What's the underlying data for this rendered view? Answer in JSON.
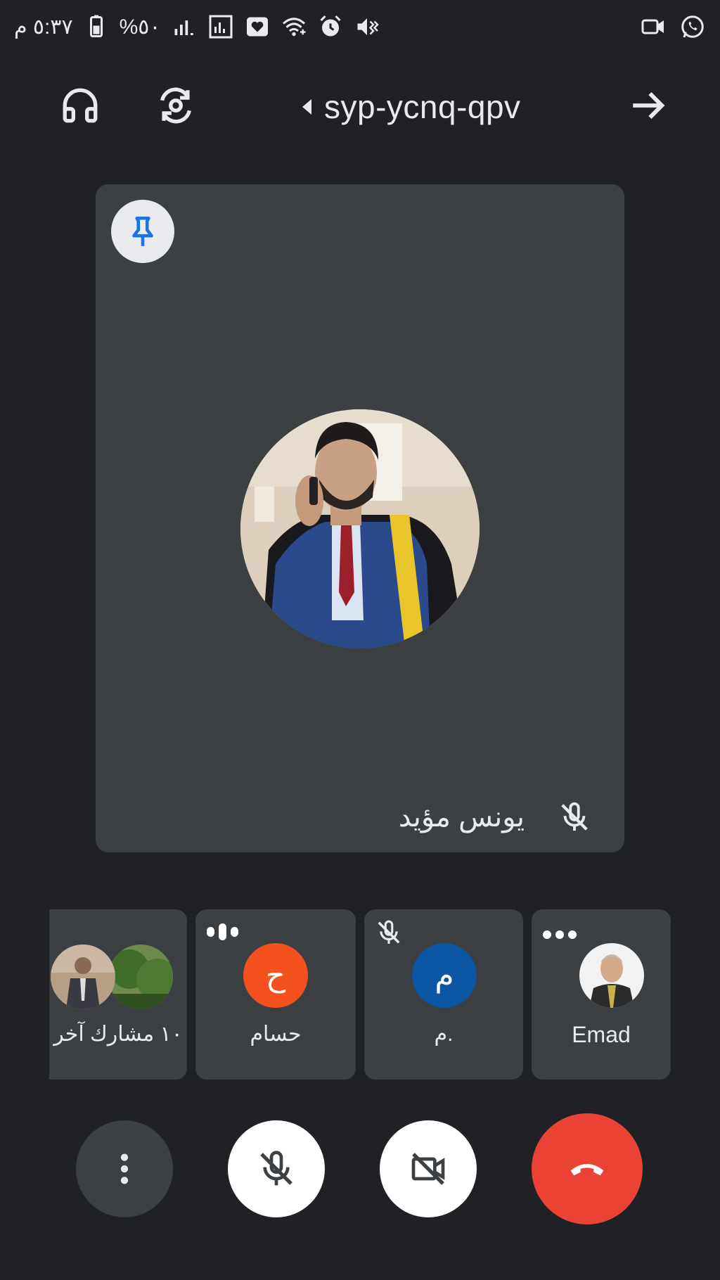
{
  "status_bar": {
    "time": "٥:٣٧ م",
    "battery": "%٥٠",
    "icons": [
      "battery-icon",
      "signal-icon",
      "signal-box-icon",
      "heart-notification-icon",
      "wifi-icon",
      "alarm-icon",
      "vibrate-icon",
      "video-call-icon",
      "whatsapp-icon"
    ]
  },
  "top_bar": {
    "meeting_code": "syp-ycnq-qpv",
    "icons": [
      "headphones-icon",
      "switch-camera-icon",
      "expand-caret-icon",
      "arrow-right-icon"
    ]
  },
  "main_tile": {
    "name": "يونس مؤيد",
    "pin_icon": "pin-icon",
    "muted": true
  },
  "participants": [
    {
      "name": "Emad",
      "avatar_type": "photo",
      "indicator": "more-dots-icon"
    },
    {
      "name": "م.",
      "avatar_letter": "م",
      "avatar_color": "#0b57a4",
      "indicator": "mic-off-icon"
    },
    {
      "name": "حسام",
      "avatar_letter": "ح",
      "avatar_color": "#f4511e",
      "indicator": "speaking-icon"
    },
    {
      "name": "١٠ مشارك آخر",
      "avatar_type": "photo-stack"
    }
  ],
  "controls": {
    "buttons": [
      "more-options-icon",
      "mic-off-icon",
      "camera-off-icon",
      "end-call-icon"
    ],
    "end_call_color": "#ea4335"
  }
}
